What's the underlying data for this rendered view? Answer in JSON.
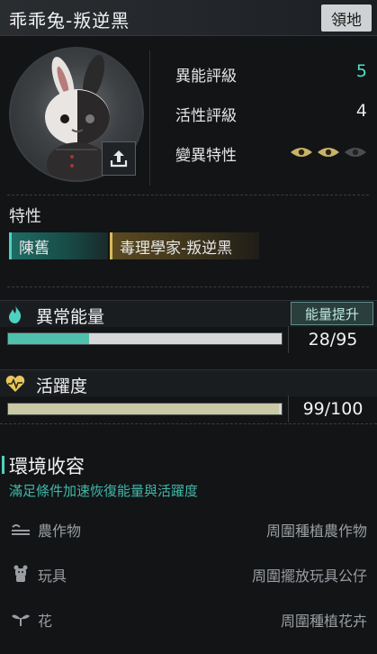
{
  "header": {
    "title": "乖乖兔-叛逆黑",
    "right_button": "領地"
  },
  "stats": [
    {
      "label": "異能評級",
      "value": "5",
      "color": "#4fe0c8"
    },
    {
      "label": "活性評級",
      "value": "4",
      "color": "#e6e6e6"
    },
    {
      "label": "變異特性",
      "eyes_lit": 2,
      "eyes_total": 3
    }
  ],
  "traits": {
    "title": "特性",
    "items": [
      "陳舊",
      "毒理學家-叛逆黑"
    ]
  },
  "energy": {
    "title": "異常能量",
    "button": "能量提升",
    "value": "28/95",
    "current": 28,
    "max": 95,
    "color": "#4fc0ac"
  },
  "activity": {
    "title": "活躍度",
    "value": "99/100",
    "current": 99,
    "max": 100,
    "color": "#c9c9a6"
  },
  "environment": {
    "title": "環境收容",
    "subtitle": "滿足條件加速恢復能量與活躍度",
    "rows": [
      {
        "name": "農作物",
        "desc": "周圍種植農作物",
        "icon": "crop-icon"
      },
      {
        "name": "玩具",
        "desc": "周圍擺放玩具公仔",
        "icon": "toy-icon"
      },
      {
        "name": "花",
        "desc": "周圍種植花卉",
        "icon": "flower-icon"
      }
    ]
  }
}
